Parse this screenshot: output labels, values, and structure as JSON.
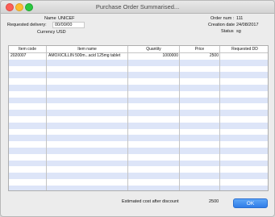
{
  "window": {
    "title": "Purchase Order Summarised..."
  },
  "header": {
    "name_label": "Name",
    "name_value": "UNICEF",
    "requested_delivery_label": "Requested delivery:",
    "requested_delivery_value": "00/00/00",
    "currency_label": "Currency",
    "currency_value": "USD",
    "order_num_label": "Order num :",
    "order_num_value": "111",
    "creation_date_label": "Creation date",
    "creation_date_value": "24/08/2017",
    "status_label": "Status",
    "status_value": "sg"
  },
  "table": {
    "columns": [
      "Item code",
      "Item name",
      "Quantity",
      "Price",
      "Requested DD"
    ],
    "rows": [
      [
        "2020007",
        "AMOXICILLIN 500m...acid 125mg tablet",
        "1000000",
        "2500",
        ""
      ]
    ]
  },
  "footer": {
    "estimated_cost_label": "Estimated cost after discount",
    "estimated_cost_value": "2500",
    "ok_label": "OK"
  },
  "colors": {
    "row_alt": "#dde5f8",
    "ok_button": "#2f7de8"
  }
}
